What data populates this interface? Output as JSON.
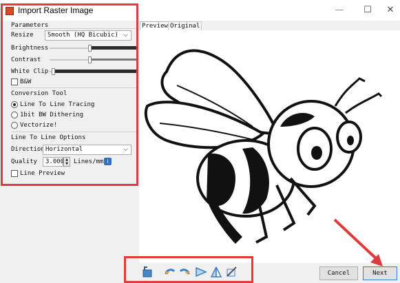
{
  "window": {
    "title": "Import Raster Image"
  },
  "window_controls": {
    "minimize": "—",
    "maximize": "☐",
    "close": "✕"
  },
  "parameters": {
    "title": "Parameters",
    "resize_label": "Resize",
    "resize_value": "Smooth (HQ Bicubic)",
    "brightness_label": "Brightness",
    "contrast_label": "Contrast",
    "white_clip_label": "White Clip",
    "bw_label": "B&W",
    "brightness_level": 0.5,
    "contrast_level": 0.5,
    "white_clip_level": 0.03,
    "bw_checked": false
  },
  "conversion_tool": {
    "title": "Conversion Tool",
    "options": [
      {
        "label": "Line To Line Tracing",
        "checked": true
      },
      {
        "label": "1bit BW Dithering",
        "checked": false
      },
      {
        "label": "Vectorize!",
        "checked": false
      }
    ]
  },
  "line_options": {
    "title": "Line To Line Options",
    "direction_label": "Direction",
    "direction_value": "Horizontal",
    "quality_label": "Quality",
    "quality_value": "3.000",
    "quality_unit": "Lines/mm",
    "line_preview_label": "Line Preview",
    "line_preview_checked": false
  },
  "tabs": {
    "preview": "Preview",
    "original": "Original"
  },
  "buttons": {
    "cancel": "Cancel",
    "next": "Next"
  },
  "toolbar_icons": [
    "reset-icon",
    "rotate-left-icon",
    "rotate-right-icon",
    "flip-horizontal-icon",
    "flip-vertical-icon",
    "crop-icon"
  ],
  "colors": {
    "annotation": "#e03b3b",
    "info": "#2c6fd1"
  }
}
